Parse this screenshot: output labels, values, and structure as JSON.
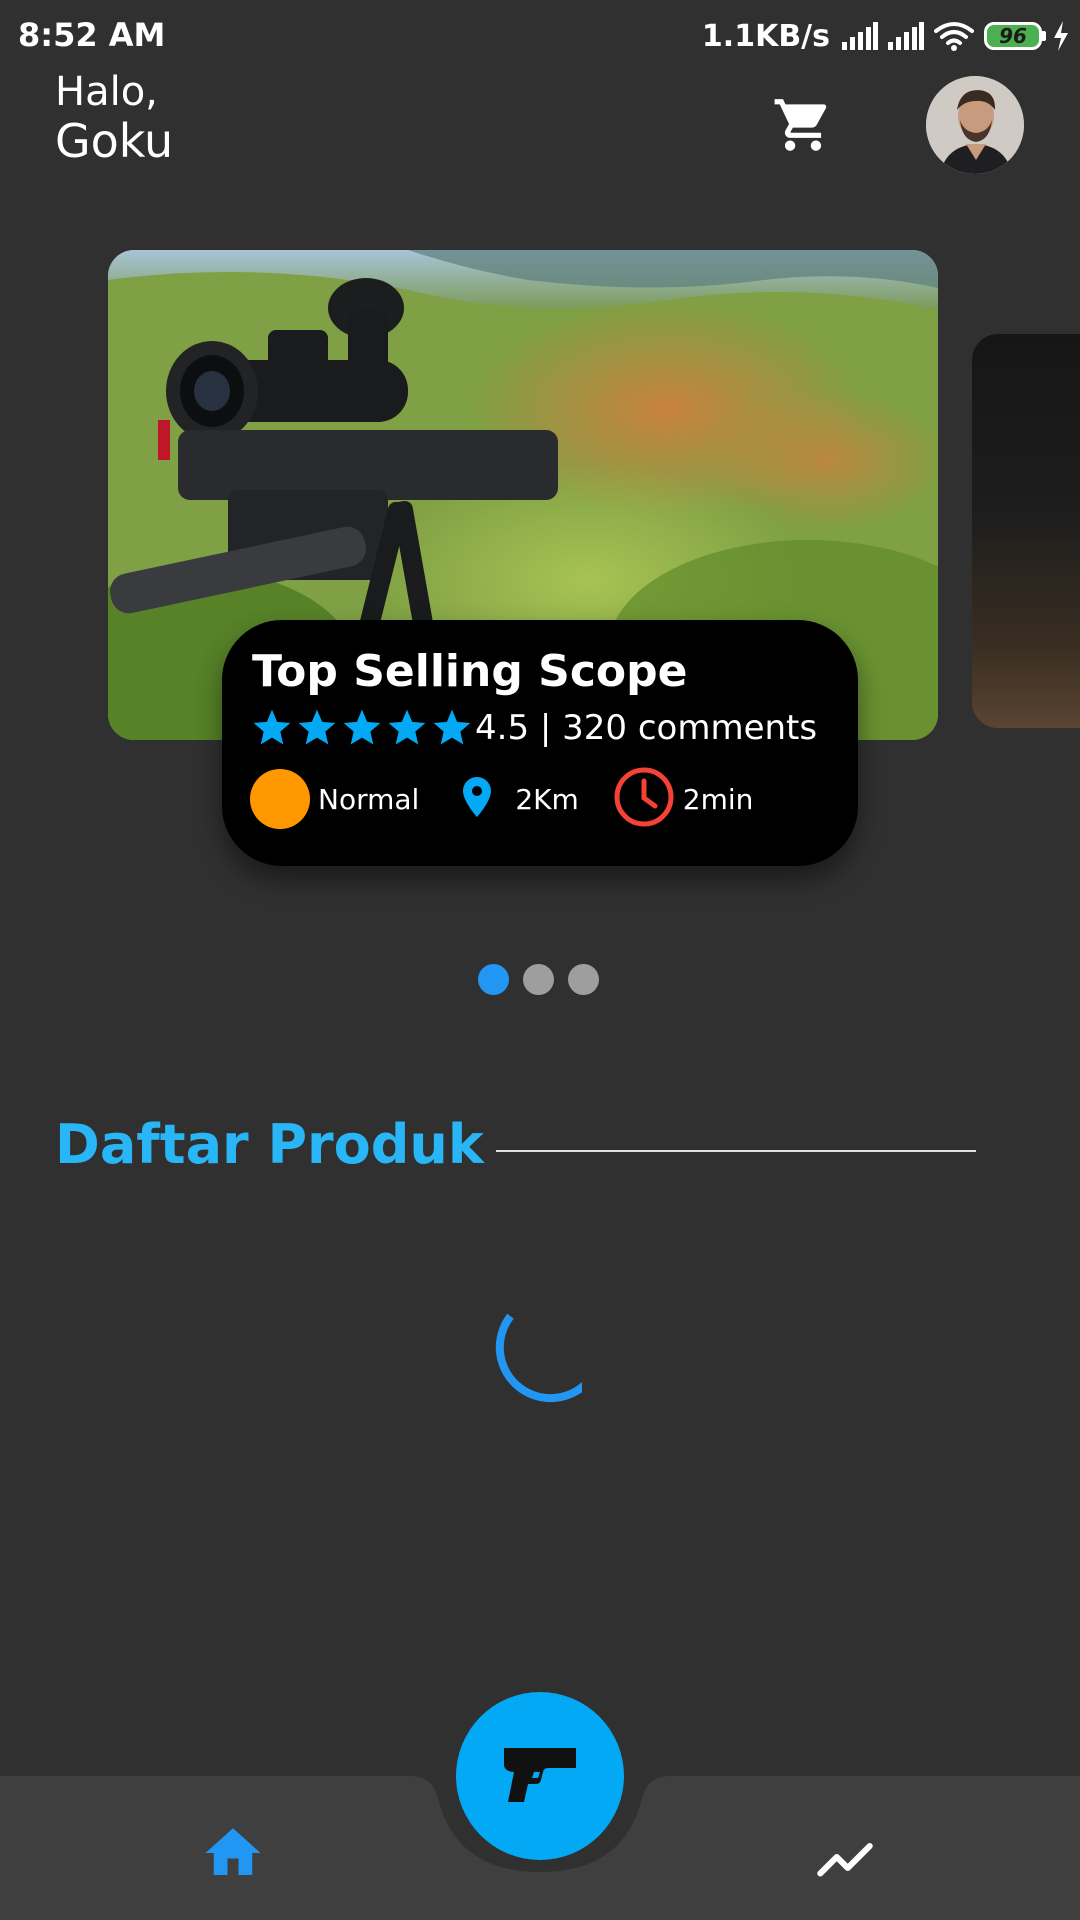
{
  "status_bar": {
    "time": "8:52 AM",
    "net_speed": "1.1KB/s",
    "battery_level": "96",
    "icons": [
      "signal-icon",
      "signal-icon",
      "wifi-icon",
      "battery-icon",
      "charging-bolt-icon"
    ]
  },
  "header": {
    "greeting": "Halo,",
    "user_name": "Goku",
    "cart_icon": "shopping-cart-icon",
    "avatar_icon": "user-avatar"
  },
  "carousel": {
    "card": {
      "title": "Top Selling Scope",
      "stars": 5,
      "rating_text": "4.5 | 320 comments",
      "difficulty": "Normal",
      "distance": "2Km",
      "duration": "2min"
    },
    "pages": 3,
    "active_page": 1
  },
  "section": {
    "title": "Daftar Produk"
  },
  "bottom_nav": {
    "left_icon": "home-icon",
    "center_icon": "pistol-icon",
    "right_icon": "trending-up-icon"
  },
  "colors": {
    "background": "#313031",
    "accent_blue": "#03a9f4",
    "title_blue": "#29b6f6",
    "active_blue": "#2196f3",
    "orange": "#ff9800",
    "clock_red": "#f44336",
    "nav_bar": "#3f3f3f"
  }
}
